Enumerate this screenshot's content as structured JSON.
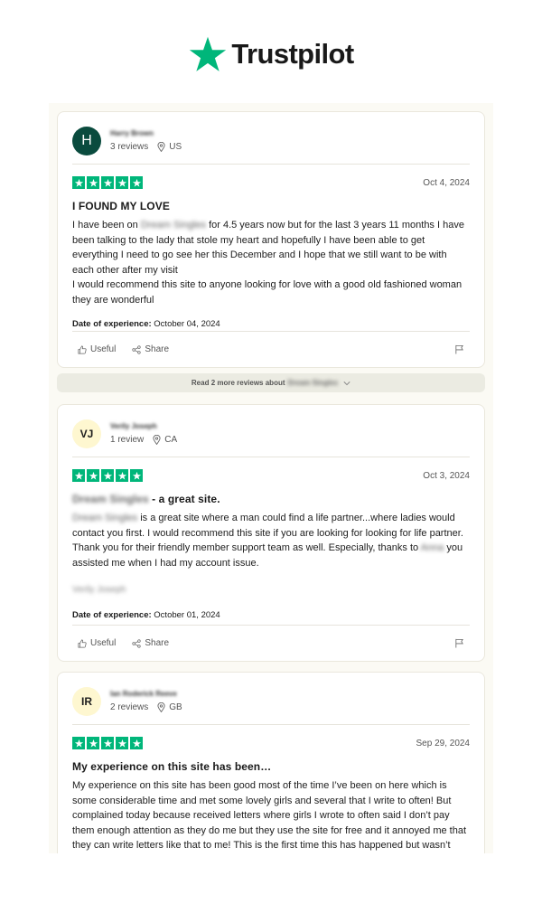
{
  "brand": {
    "name": "Trustpilot",
    "color": "#00b67a"
  },
  "reviews": [
    {
      "avatar": "H",
      "avatar_style": "dark",
      "name": "Harry Brown",
      "review_count": "3 reviews",
      "country": "US",
      "rating": 5,
      "date": "Oct 4, 2024",
      "title": "I FOUND MY LOVE",
      "body_pre": "I have been on",
      "body_blur": "Dream Singles",
      "body_post": "for 4.5 years now but for the last 3 years 11 months I have been talking to the lady that stole my heart and hopefully I have been able to get everything I need to go see her this December and I hope that we still want to be with each other after my visit",
      "body_line2": "I would recommend this site to anyone looking for love with a good old fashioned woman they are wonderful",
      "experience_label": "Date of experience:",
      "experience_date": "October 04, 2024",
      "useful_label": "Useful",
      "share_label": "Share"
    },
    {
      "avatar": "VJ",
      "avatar_style": "light",
      "name": "Verily Joseph",
      "review_count": "1 review",
      "country": "CA",
      "rating": 5,
      "date": "Oct 3, 2024",
      "title_blur": "Dream Singles",
      "title": "- a great site.",
      "body_blur": "Dream Singles",
      "body_post": "is a great site where a man could find a life partner...where ladies would contact you first. I would recommend this site if you are looking for looking for life partner. Thank you for their friendly member support team as well. Especially, thanks to",
      "body_blur2": "Anna",
      "body_post2": "you assisted me when I had my account issue.",
      "signature_blur": "Verily Joseph",
      "experience_label": "Date of experience:",
      "experience_date": "October 01, 2024",
      "useful_label": "Useful",
      "share_label": "Share"
    },
    {
      "avatar": "IR",
      "avatar_style": "light",
      "name": "Ian Roderick Reeve",
      "review_count": "2 reviews",
      "country": "GB",
      "rating": 5,
      "date": "Sep 29, 2024",
      "title": "My experience on this site has been…",
      "body": "My experience on this site has been good most of the time I’ve been on here which is some considerable time and met some lovely girls and several that I write to often! But complained today because received letters where girls I wrote to often said I don’t pay them enough attention as they do me but they use the site for free and it annoyed me that they can write letters like that to me! This is the first time this has happened but wasn’t impressed they can get away with it!"
    }
  ],
  "more_reviews": {
    "label": "Read 2 more reviews about",
    "name_blur": "Dream Singles"
  }
}
